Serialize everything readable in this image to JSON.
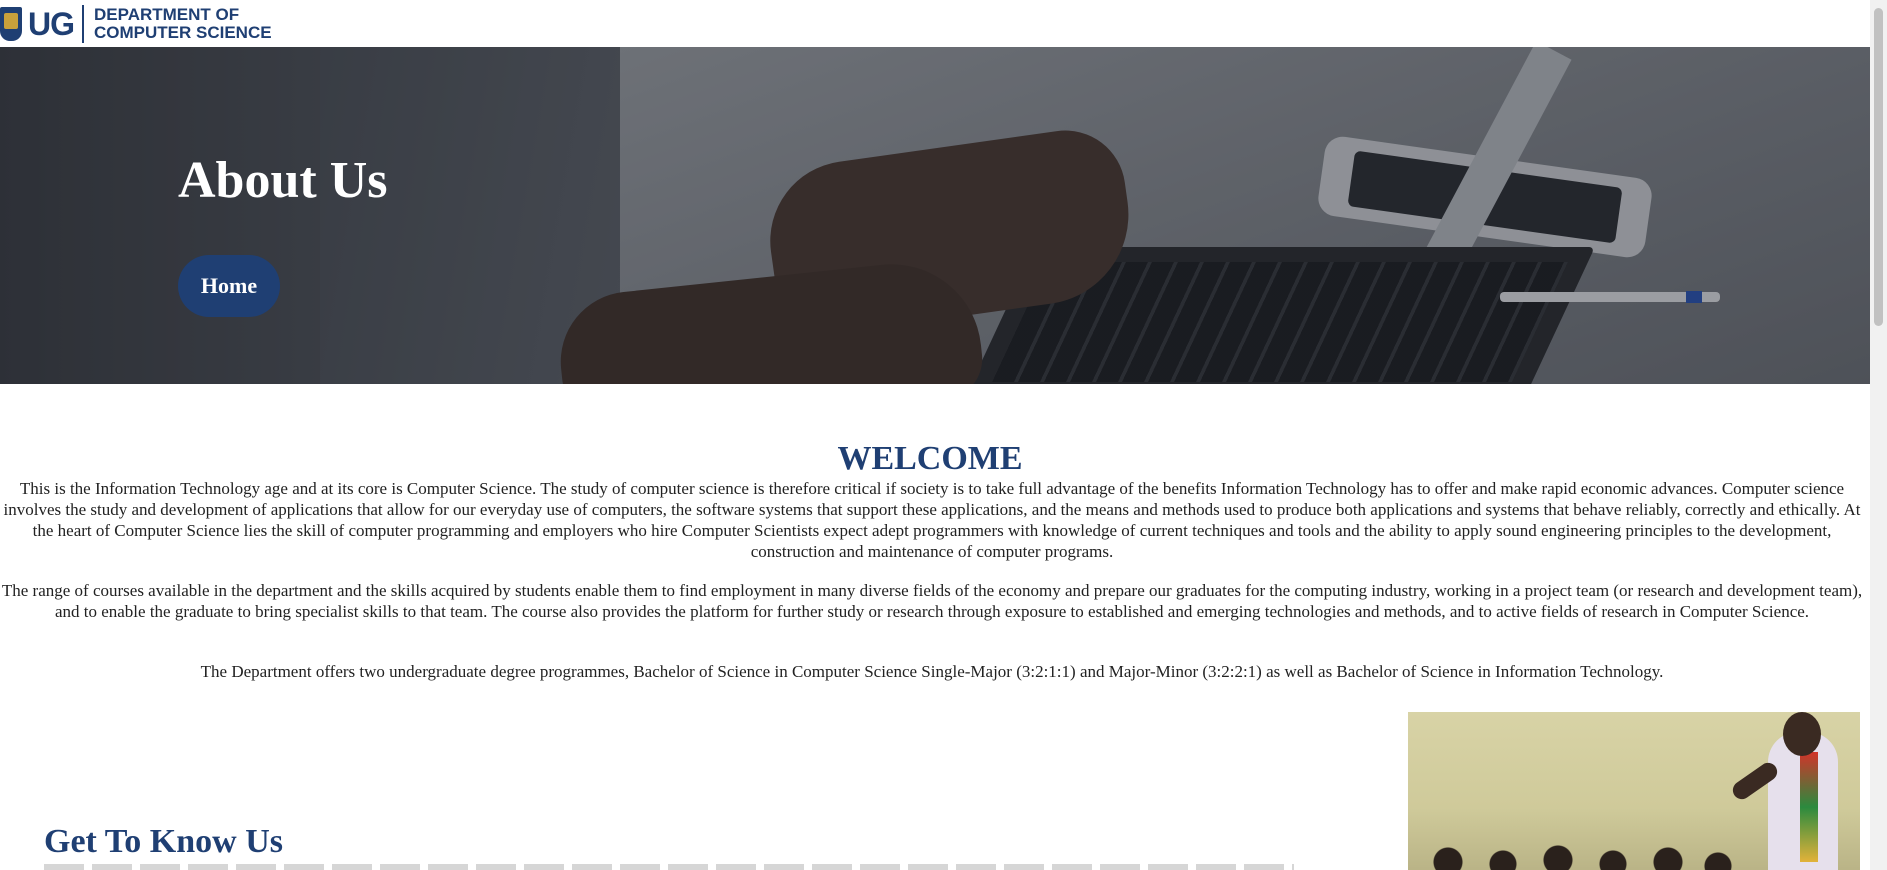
{
  "header": {
    "logo_abbr": "UG",
    "logo_line1": "DEPARTMENT OF",
    "logo_line2": "COMPUTER SCIENCE"
  },
  "hero": {
    "title": "About Us",
    "home_button": "Home"
  },
  "welcome": {
    "title": "WELCOME",
    "paragraph1": "This is the Information Technology age and at its core is Computer Science. The study of computer science is therefore critical if society is to take full advantage of the benefits Information Technology has to offer and make rapid economic advances. Computer science involves the study and development of applications that allow for our everyday use of computers, the software systems that support these applications, and the means and methods used to produce both applications and systems that behave reliably, correctly and ethically. At the heart of Computer Science lies the skill of computer programming and employers who hire Computer Scientists expect adept programmers with knowledge of current techniques and tools and the ability to apply sound engineering principles to the development, construction and maintenance of computer programs.",
    "paragraph2": "The range of courses available in the department and the skills acquired by students enable them to find employment in many diverse fields of the economy and prepare our graduates for the computing industry, working in a project team (or research and development team), and to enable the graduate to bring specialist skills to that team. The course also provides the platform for further study or research through exposure to established and emerging technologies and methods, and to active fields of research in Computer Science.",
    "paragraph3": "The Department offers two undergraduate degree programmes, Bachelor of Science in Computer Science Single-Major (3:2:1:1) and Major-Minor (3:2:2:1) as well as Bachelor of Science in Information Technology."
  },
  "get_to_know": {
    "title": "Get To Know Us"
  },
  "colors": {
    "brand_navy": "#1f3f73",
    "hero_overlay": "#14181f"
  },
  "icons": {
    "logo_crest": "ug-crest-icon"
  }
}
